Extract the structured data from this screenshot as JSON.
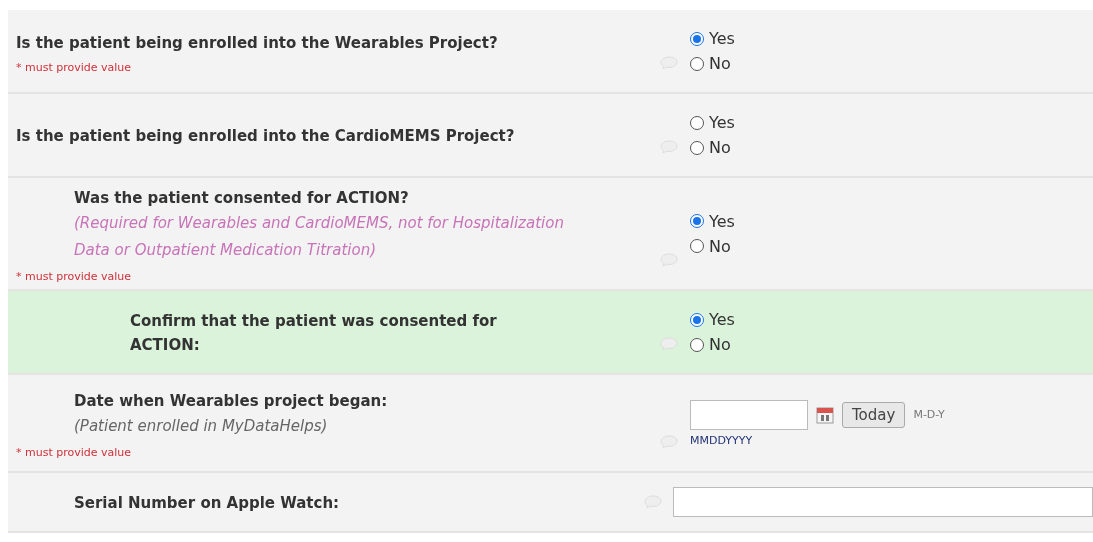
{
  "questions": [
    {
      "kind": "radio",
      "label": "Is the patient being enrolled into the Wearables Project?",
      "required_note": "* must provide value",
      "highlighted": false,
      "options": [
        {
          "label": "Yes",
          "selected": true
        },
        {
          "label": "No",
          "selected": false
        }
      ]
    },
    {
      "kind": "radio",
      "label": "Is the patient being enrolled into the CardioMEMS Project?",
      "highlighted": false,
      "options": [
        {
          "label": "Yes",
          "selected": false
        },
        {
          "label": "No",
          "selected": false
        }
      ],
      "children": [
        {
          "kind": "radio",
          "label": "Was the patient consented for ACTION?",
          "note": {
            "kind": "instruction",
            "text": "(Required for Wearables and CardioMEMS, not for Hospitalization Data or Outpatient Medication Titration)"
          },
          "required_note": "* must provide value",
          "highlighted": false,
          "options": [
            {
              "label": "Yes",
              "selected": true
            },
            {
              "label": "No",
              "selected": false
            }
          ],
          "children": [
            {
              "kind": "radio",
              "label": "Confirm that the patient was consented for ACTION:",
              "highlighted": true,
              "options": [
                {
                  "label": "Yes",
                  "selected": true
                },
                {
                  "label": "No",
                  "selected": false
                }
              ]
            }
          ]
        },
        {
          "kind": "date",
          "label": "Date when Wearables project began:",
          "note": {
            "kind": "hint",
            "text": "(Patient enrolled in MyDataHelps)"
          },
          "required_note": "* must provide value",
          "highlighted": false,
          "button": "Today",
          "format": "M-D-Y",
          "hint": "MMDDYYYY"
        },
        {
          "kind": "text",
          "label": "Serial Number on Apple Watch:",
          "highlighted": false
        }
      ]
    }
  ]
}
